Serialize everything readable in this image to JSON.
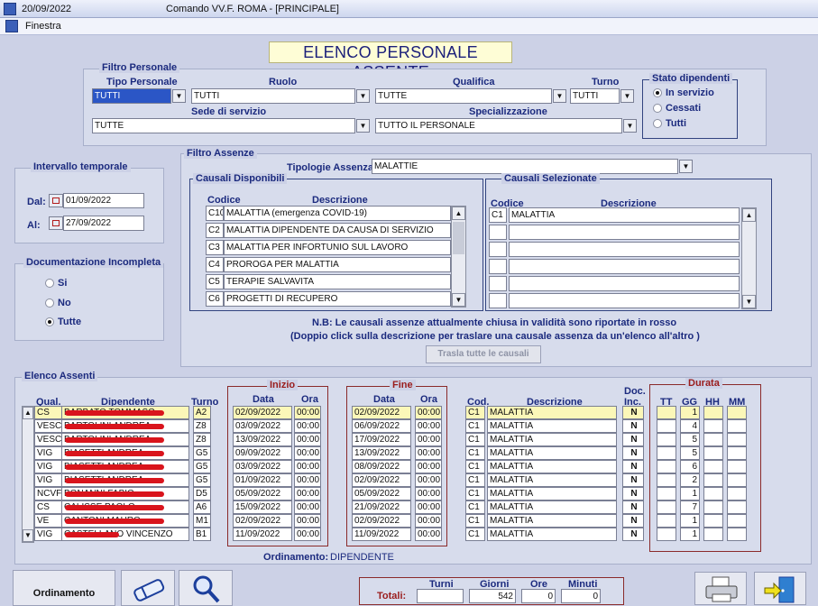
{
  "window": {
    "date": "20/09/2022",
    "title": "Comando VV.F. ROMA - [PRINCIPALE]"
  },
  "menu": {
    "finestra": "Finestra"
  },
  "heading": "ELENCO PERSONALE ASSENTE",
  "filtro_personale": {
    "title": "Filtro Personale",
    "tipo_label": "Tipo Personale",
    "tipo_value": "TUTTI",
    "ruolo_label": "Ruolo",
    "ruolo_value": "TUTTI",
    "qualifica_label": "Qualifica",
    "qualifica_value": "TUTTE",
    "turno_label": "Turno",
    "turno_value": "TUTTI",
    "sede_label": "Sede di servizio",
    "sede_value": "TUTTE",
    "spec_label": "Specializzazione",
    "spec_value": "TUTTO IL PERSONALE"
  },
  "stato": {
    "title": "Stato dipendenti",
    "opt1": "In servizio",
    "opt2": "Cessati",
    "opt3": "Tutti"
  },
  "intervallo": {
    "title": "Intervallo temporale",
    "dal_label": "Dal:",
    "dal_value": "01/09/2022",
    "al_label": "Al:",
    "al_value": "27/09/2022"
  },
  "documentazione": {
    "title": "Documentazione Incompleta",
    "opt1": "Si",
    "opt2": "No",
    "opt3": "Tutte"
  },
  "filtro_assenze": {
    "title": "Filtro Assenze",
    "tipologie_label": "Tipologie Assenza",
    "tipologie_value": "MALATTIE",
    "disponibili_title": "Causali Disponibili",
    "selezionate_title": "Causali Selezionate",
    "codice_label": "Codice",
    "descrizione_label": "Descrizione",
    "disponibili": [
      {
        "code": "C10",
        "desc": "MALATTIA (emergenza COVID-19)"
      },
      {
        "code": "C2",
        "desc": "MALATTIA DIPENDENTE DA CAUSA DI SERVIZIO"
      },
      {
        "code": "C3",
        "desc": "MALATTIA PER INFORTUNIO SUL LAVORO"
      },
      {
        "code": "C4",
        "desc": "PROROGA PER MALATTIA"
      },
      {
        "code": "C5",
        "desc": "TERAPIE SALVAVITA"
      },
      {
        "code": "C6",
        "desc": "PROGETTI DI RECUPERO"
      }
    ],
    "selezionate": [
      {
        "code": "C1",
        "desc": "MALATTIA"
      }
    ],
    "note1": "N.B: Le causali assenze attualmente chiusa in validità sono riportate in rosso",
    "note2": "(Doppio click sulla descrizione per traslare una causale assenza da un'elenco all'altro )",
    "trasla_button": "Trasla tutte le causali"
  },
  "elenco": {
    "title": "Elenco Assenti",
    "col_qual": "Qual.",
    "col_dip": "Dipendente",
    "col_turno": "Turno",
    "inizio_title": "Inizio",
    "fine_title": "Fine",
    "col_data": "Data",
    "col_ora": "Ora",
    "col_cod": "Cod.",
    "col_desc": "Descrizione",
    "col_doc1": "Doc.",
    "col_doc2": "Inc.",
    "durata_title": "Durata",
    "col_tt": "TT",
    "col_gg": "GG",
    "col_hh": "HH",
    "col_mm": "MM",
    "rows": [
      {
        "qual": "CS",
        "name": "BARBATO TOMMASO",
        "turno": "A2",
        "di": "02/09/2022",
        "oi": "00:00",
        "df": "02/09/2022",
        "of": "00:00",
        "cod": "C1",
        "desc": "MALATTIA",
        "doc": "N",
        "gg": "1"
      },
      {
        "qual": "VESC",
        "name": "BARTOLINI ANDREA",
        "turno": "Z8",
        "di": "03/09/2022",
        "oi": "00:00",
        "df": "06/09/2022",
        "of": "00:00",
        "cod": "C1",
        "desc": "MALATTIA",
        "doc": "N",
        "gg": "4"
      },
      {
        "qual": "VESC",
        "name": "BARTOLINI ANDREA",
        "turno": "Z8",
        "di": "13/09/2022",
        "oi": "00:00",
        "df": "17/09/2022",
        "of": "00:00",
        "cod": "C1",
        "desc": "MALATTIA",
        "doc": "N",
        "gg": "5"
      },
      {
        "qual": "VIG",
        "name": "BIASETTI ANDREA",
        "turno": "G5",
        "di": "09/09/2022",
        "oi": "00:00",
        "df": "13/09/2022",
        "of": "00:00",
        "cod": "C1",
        "desc": "MALATTIA",
        "doc": "N",
        "gg": "5"
      },
      {
        "qual": "VIG",
        "name": "BIASETTI ANDREA",
        "turno": "G5",
        "di": "03/09/2022",
        "oi": "00:00",
        "df": "08/09/2022",
        "of": "00:00",
        "cod": "C1",
        "desc": "MALATTIA",
        "doc": "N",
        "gg": "6"
      },
      {
        "qual": "VIG",
        "name": "BIASETTI ANDREA",
        "turno": "G5",
        "di": "01/09/2022",
        "oi": "00:00",
        "df": "02/09/2022",
        "of": "00:00",
        "cod": "C1",
        "desc": "MALATTIA",
        "doc": "N",
        "gg": "2"
      },
      {
        "qual": "NCVF",
        "name": "BONANNI FABIO",
        "turno": "D5",
        "di": "05/09/2022",
        "oi": "00:00",
        "df": "05/09/2022",
        "of": "00:00",
        "cod": "C1",
        "desc": "MALATTIA",
        "doc": "N",
        "gg": "1"
      },
      {
        "qual": "CS",
        "name": "CALISSE PAOLO",
        "turno": "A6",
        "di": "15/09/2022",
        "oi": "00:00",
        "df": "21/09/2022",
        "of": "00:00",
        "cod": "C1",
        "desc": "MALATTIA",
        "doc": "N",
        "gg": "7"
      },
      {
        "qual": "VE",
        "name": "CANTONI MAURO",
        "turno": "M1",
        "di": "02/09/2022",
        "oi": "00:00",
        "df": "02/09/2022",
        "of": "00:00",
        "cod": "C1",
        "desc": "MALATTIA",
        "doc": "N",
        "gg": "1"
      },
      {
        "qual": "VIG",
        "name": "CASTELLANO VINCENZO",
        "turno": "B1",
        "di": "11/09/2022",
        "oi": "00:00",
        "df": "11/09/2022",
        "of": "00:00",
        "cod": "C1",
        "desc": "MALATTIA",
        "doc": "N",
        "gg": "1"
      }
    ],
    "ordinamento_label": "Ordinamento:",
    "ordinamento_value": "DIPENDENTE"
  },
  "footer": {
    "ordinamento_button": "Ordinamento",
    "totali_label": "Totali:",
    "turni_label": "Turni",
    "giorni_label": "Giorni",
    "ore_label": "Ore",
    "minuti_label": "Minuti",
    "turni_value": "",
    "giorni_value": "542",
    "ore_value": "0",
    "minuti_value": "0"
  },
  "icons": {
    "app": "app-icon",
    "calendar": "calendar-icon",
    "eraser": "eraser-icon",
    "search": "magnifier-icon",
    "print": "printer-icon",
    "exit": "exit-door-icon"
  }
}
